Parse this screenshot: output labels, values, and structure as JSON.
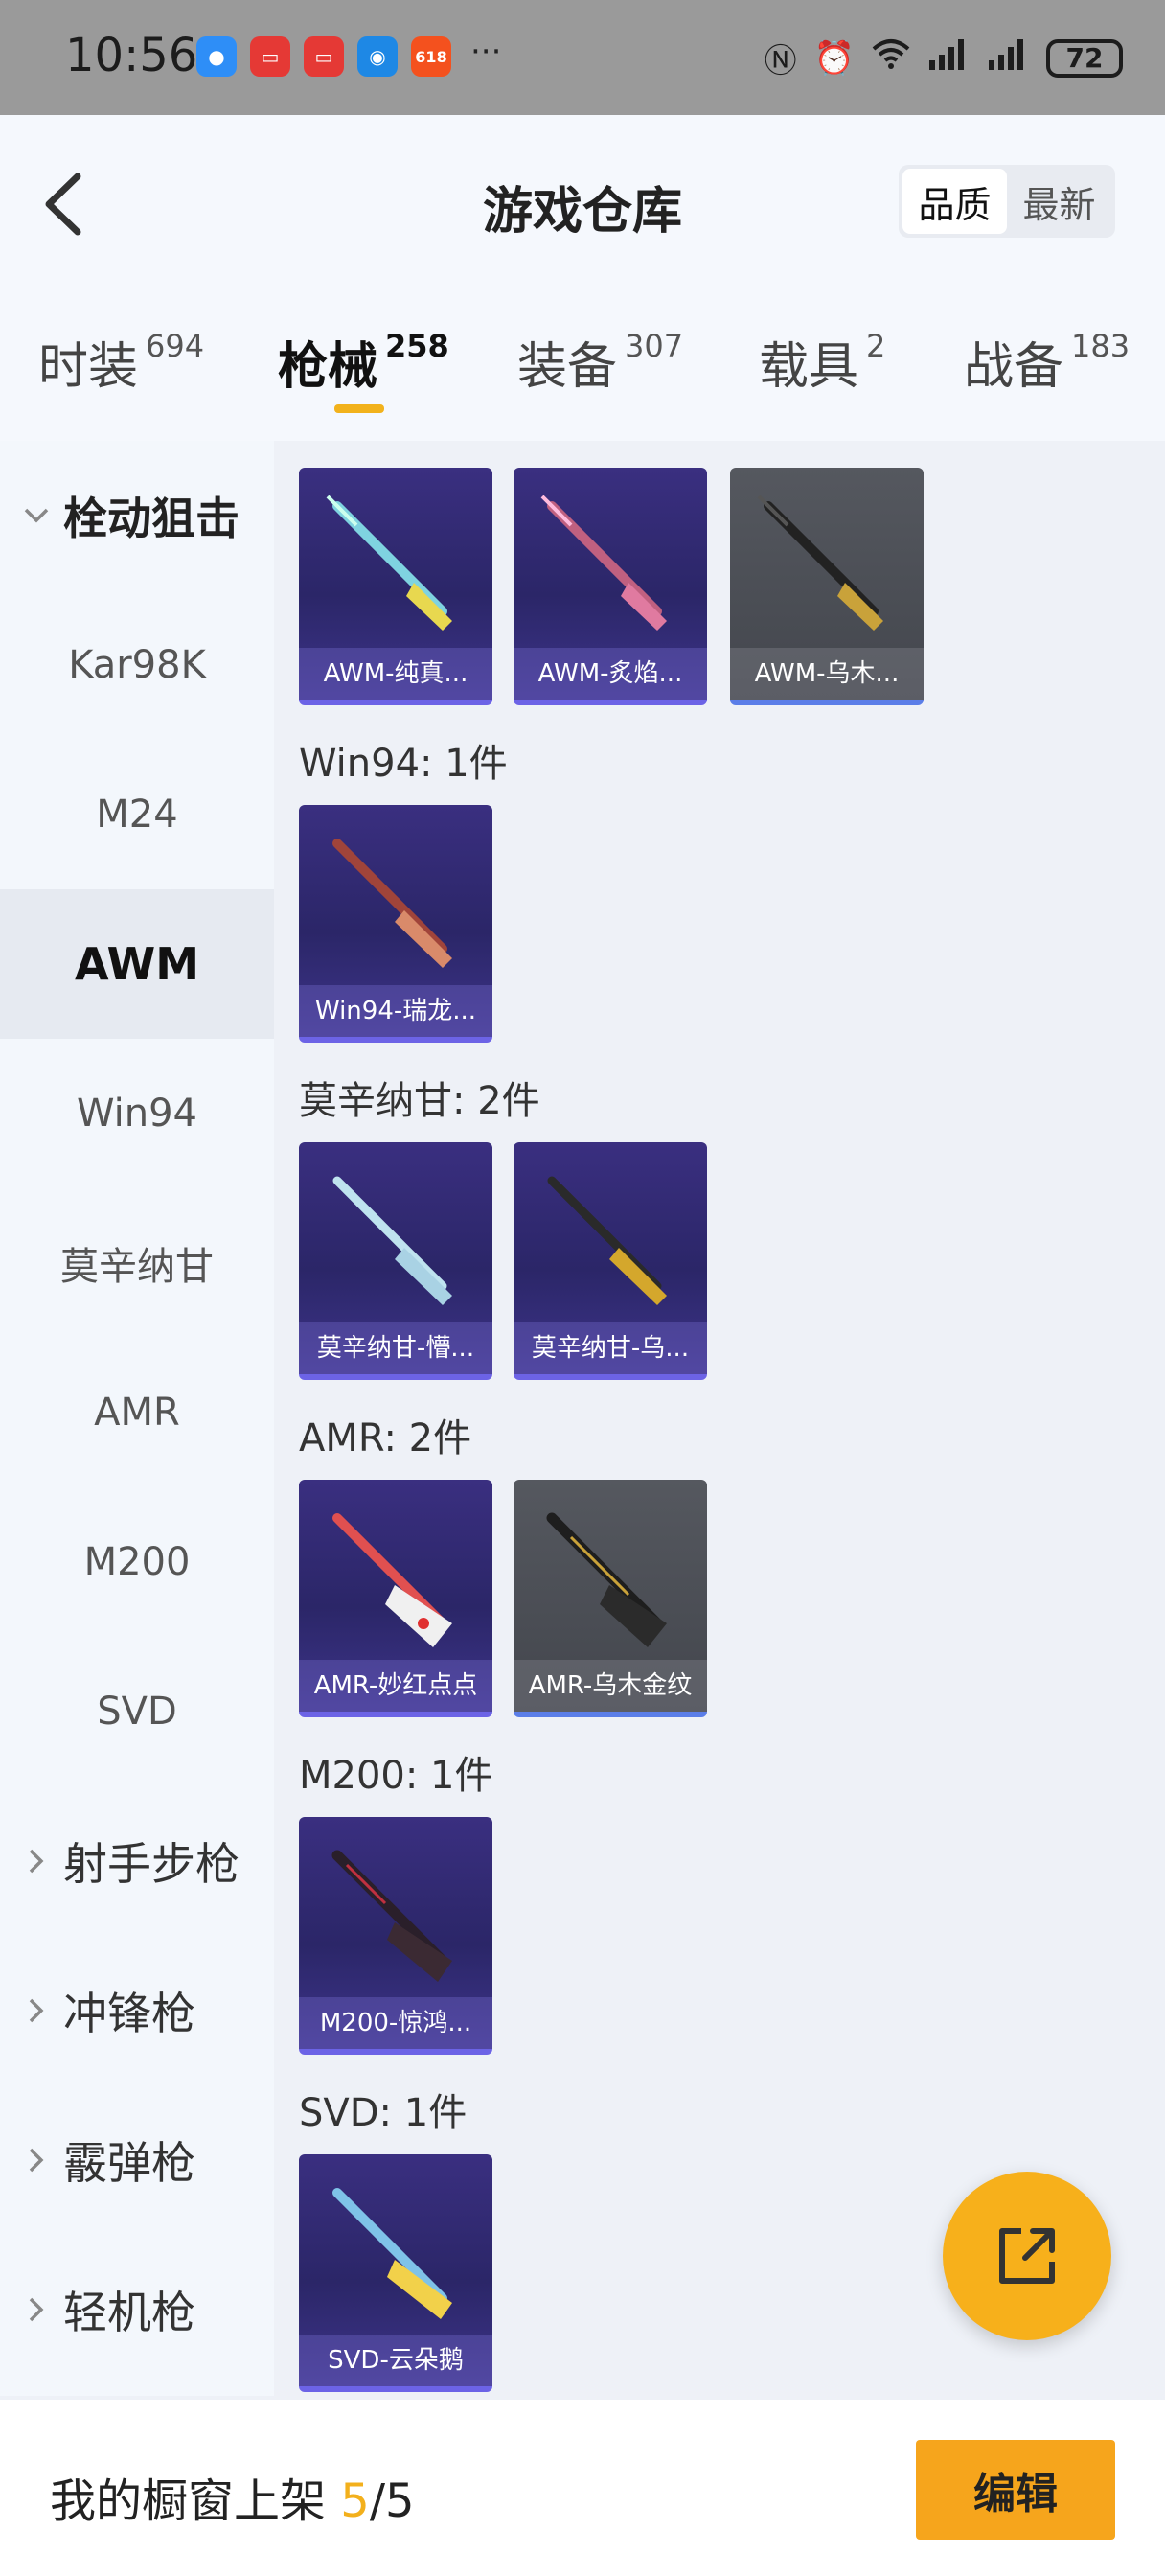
{
  "status_bar": {
    "time": "10:56",
    "app_badge": "618",
    "more": "···",
    "battery": "72"
  },
  "header": {
    "title": "游戏仓库",
    "sort": {
      "quality": "品质",
      "newest": "最新",
      "active": "quality"
    }
  },
  "tabs": [
    {
      "label": "时装",
      "count": "694"
    },
    {
      "label": "枪械",
      "count": "258",
      "active": true
    },
    {
      "label": "装备",
      "count": "307"
    },
    {
      "label": "载具",
      "count": "2"
    },
    {
      "label": "战备",
      "count": "183"
    }
  ],
  "sidebar": {
    "group_open": "栓动狙击",
    "items": [
      "Kar98K",
      "M24",
      "AWM",
      "Win94",
      "莫辛纳甘",
      "AMR",
      "M200",
      "SVD"
    ],
    "active_item": "AWM",
    "groups": [
      "射手步枪",
      "冲锋枪",
      "霰弹枪",
      "轻机枪"
    ]
  },
  "sections": [
    {
      "label": "",
      "items": [
        {
          "name": "AWM-纯真...",
          "rarity": "purple"
        },
        {
          "name": "AWM-炙焰...",
          "rarity": "purple"
        },
        {
          "name": "AWM-乌木...",
          "rarity": "gray"
        }
      ]
    },
    {
      "label": "Win94: 1件",
      "items": [
        {
          "name": "Win94-瑞龙...",
          "rarity": "purple"
        }
      ]
    },
    {
      "label": "莫辛纳甘: 2件",
      "items": [
        {
          "name": "莫辛纳甘-懵...",
          "rarity": "purple"
        },
        {
          "name": "莫辛纳甘-乌...",
          "rarity": "purple"
        }
      ]
    },
    {
      "label": "AMR: 2件",
      "items": [
        {
          "name": "AMR-妙红点点",
          "rarity": "purple"
        },
        {
          "name": "AMR-乌木金纹",
          "rarity": "gray"
        }
      ]
    },
    {
      "label": "M200: 1件",
      "items": [
        {
          "name": "M200-惊鸿...",
          "rarity": "purple"
        }
      ]
    },
    {
      "label": "SVD: 1件",
      "items": [
        {
          "name": "SVD-云朵鹅",
          "rarity": "purple"
        }
      ]
    }
  ],
  "bottom": {
    "showcase_label": "我的橱窗上架",
    "current": "5",
    "separator": "/",
    "total": "5",
    "edit_label": "编辑"
  },
  "icons": {
    "back": "back-arrow-icon",
    "chevron_down": "chevron-down-icon",
    "chevron_right": "chevron-right-icon",
    "share": "share-external-icon"
  },
  "colors": {
    "accent": "#f6a51c",
    "purple_card": "#2b2668",
    "gray_card": "#43464d"
  }
}
